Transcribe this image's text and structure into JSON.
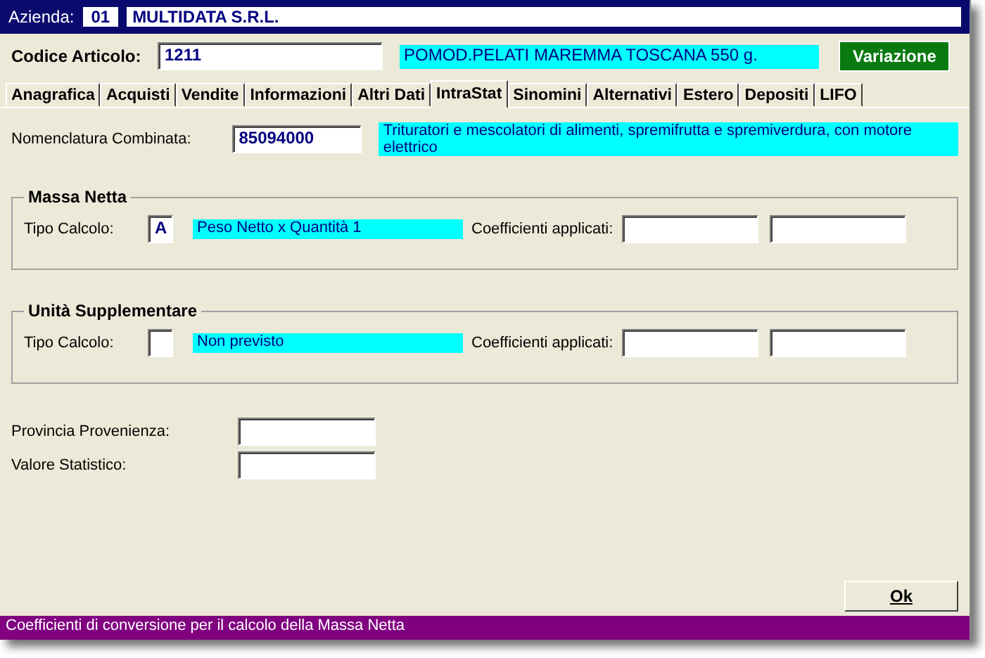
{
  "header": {
    "label": "Azienda:",
    "code": "01",
    "name": "MULTIDATA S.R.L."
  },
  "article": {
    "label": "Codice Articolo:",
    "code": "1211",
    "description": "POMOD.PELATI MAREMMA TOSCANA 550 g.",
    "mode": "Variazione"
  },
  "tabs": [
    {
      "label": "Anagrafica",
      "selected": false
    },
    {
      "label": "Acquisti",
      "selected": false
    },
    {
      "label": "Vendite",
      "selected": false
    },
    {
      "label": "Informazioni",
      "selected": false
    },
    {
      "label": "Altri Dati",
      "selected": false
    },
    {
      "label": "IntraStat",
      "selected": true
    },
    {
      "label": "Sinomini",
      "selected": false
    },
    {
      "label": "Alternativi",
      "selected": false
    },
    {
      "label": "Estero",
      "selected": false
    },
    {
      "label": "Depositi",
      "selected": false
    },
    {
      "label": "LIFO",
      "selected": false
    }
  ],
  "nomenclatura": {
    "label": "Nomenclatura Combinata:",
    "code": "85094000",
    "description": "Trituratori e mescolatori di alimenti, spremifrutta e spremiverdura, con motore elettrico"
  },
  "groups": [
    {
      "title": "Massa Netta",
      "type_label": "Tipo Calcolo:",
      "type_value": "A",
      "description": "Peso Netto x Quantità 1",
      "coeff_label": "Coefficienti applicati:"
    },
    {
      "title": "Unità Supplementare",
      "type_label": "Tipo Calcolo:",
      "description": "Non previsto",
      "coeff_label": "Coefficienti applicati:"
    }
  ],
  "extra_fields": [
    {
      "label": "Provincia Provenienza:"
    },
    {
      "label": "Valore Statistico:"
    }
  ],
  "ok_button": "Ok",
  "status_bar": "Coefficienti di conversione per il calcolo della Massa Netta"
}
